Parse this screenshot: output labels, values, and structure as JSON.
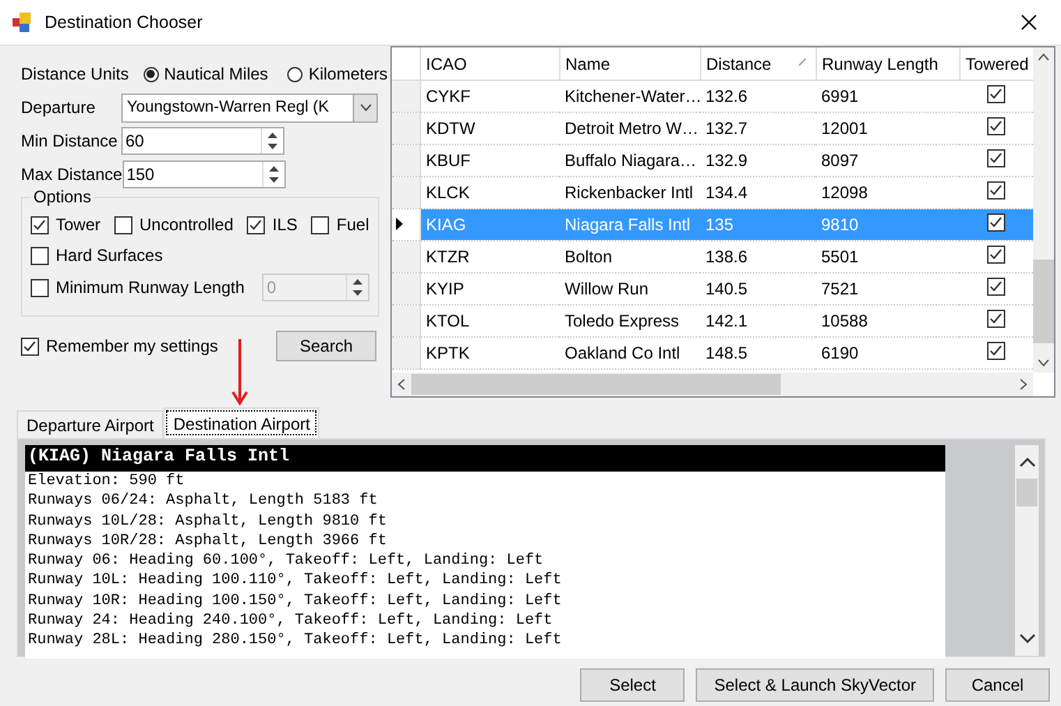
{
  "window": {
    "title": "Destination Chooser"
  },
  "units": {
    "label": "Distance Units",
    "options": [
      {
        "label": "Nautical Miles",
        "selected": true
      },
      {
        "label": "Kilometers",
        "selected": false
      }
    ]
  },
  "departure": {
    "label": "Departure",
    "value": "Youngstown-Warren Regl (K"
  },
  "min_distance": {
    "label": "Min Distance",
    "value": "60"
  },
  "max_distance": {
    "label": "Max Distance",
    "value": "150"
  },
  "options": {
    "title": "Options",
    "row1": [
      {
        "label": "Tower",
        "checked": true
      },
      {
        "label": "Uncontrolled",
        "checked": false
      },
      {
        "label": "ILS",
        "checked": true
      },
      {
        "label": "Fuel",
        "checked": false
      }
    ],
    "hard_surfaces": {
      "label": "Hard Surfaces",
      "checked": false
    },
    "min_runway": {
      "label": "Minimum Runway Length",
      "checked": false,
      "value": "0",
      "disabled": true
    }
  },
  "remember": {
    "label": "Remember my settings",
    "checked": true
  },
  "search_button": "Search",
  "table": {
    "columns": [
      {
        "label": "ICAO",
        "sorted": false
      },
      {
        "label": "Name",
        "sorted": false
      },
      {
        "label": "Distance",
        "sorted": true
      },
      {
        "label": "Runway Length",
        "sorted": false
      },
      {
        "label": "Towered",
        "sorted": false
      }
    ],
    "rows": [
      {
        "icao": "CYKF",
        "name": "Kitchener-Water…",
        "distance": "132.6",
        "runway_length": "6991",
        "towered": true,
        "selected": false
      },
      {
        "icao": "KDTW",
        "name": "Detroit Metro W…",
        "distance": "132.7",
        "runway_length": "12001",
        "towered": true,
        "selected": false
      },
      {
        "icao": "KBUF",
        "name": "Buffalo Niagara…",
        "distance": "132.9",
        "runway_length": "8097",
        "towered": true,
        "selected": false
      },
      {
        "icao": "KLCK",
        "name": "Rickenbacker Intl",
        "distance": "134.4",
        "runway_length": "12098",
        "towered": true,
        "selected": false
      },
      {
        "icao": "KIAG",
        "name": "Niagara Falls Intl",
        "distance": "135",
        "runway_length": "9810",
        "towered": true,
        "selected": true
      },
      {
        "icao": "KTZR",
        "name": "Bolton",
        "distance": "138.6",
        "runway_length": "5501",
        "towered": true,
        "selected": false
      },
      {
        "icao": "KYIP",
        "name": "Willow Run",
        "distance": "140.5",
        "runway_length": "7521",
        "towered": true,
        "selected": false
      },
      {
        "icao": "KTOL",
        "name": "Toledo Express",
        "distance": "142.1",
        "runway_length": "10588",
        "towered": true,
        "selected": false
      },
      {
        "icao": "KPTK",
        "name": "Oakland Co Intl",
        "distance": "148.5",
        "runway_length": "6190",
        "towered": true,
        "selected": false
      }
    ]
  },
  "tabs": [
    {
      "label": "Departure Airport",
      "selected": false
    },
    {
      "label": "Destination Airport",
      "selected": true
    }
  ],
  "detail": {
    "title": "(KIAG) Niagara Falls Intl",
    "lines": [
      "Elevation: 590 ft",
      "Runways 06/24: Asphalt, Length 5183 ft",
      "Runways 10L/28: Asphalt, Length 9810 ft",
      "Runways 10R/28: Asphalt, Length 3966 ft",
      "Runway 06: Heading 60.100°, Takeoff: Left, Landing: Left",
      "Runway 10L: Heading 100.110°, Takeoff: Left, Landing: Left",
      "Runway 10R: Heading 100.150°, Takeoff: Left, Landing: Left",
      "Runway 24: Heading 240.100°, Takeoff: Left, Landing: Left",
      "Runway 28L: Heading 280.150°, Takeoff: Left, Landing: Left"
    ]
  },
  "buttons": [
    "Select",
    "Select & Launch SkyVector",
    "Cancel"
  ]
}
